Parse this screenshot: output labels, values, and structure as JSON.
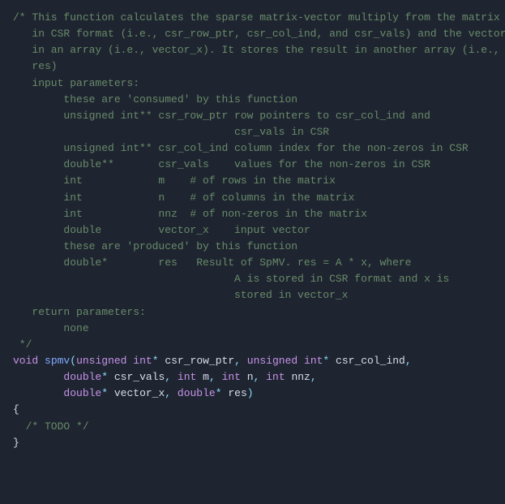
{
  "code": {
    "lines": [
      {
        "type": "comment",
        "text": "/* This function calculates the sparse matrix-vector multiply from the matrix"
      },
      {
        "type": "comment",
        "text": "   in CSR format (i.e., csr_row_ptr, csr_col_ind, and csr_vals) and the vector"
      },
      {
        "type": "comment",
        "text": "   in an array (i.e., vector_x). It stores the result in another array (i.e.,"
      },
      {
        "type": "comment",
        "text": "   res)"
      },
      {
        "type": "comment",
        "text": "   input parameters:"
      },
      {
        "type": "comment",
        "text": "        these are 'consumed' by this function"
      },
      {
        "type": "comment",
        "text": "        unsigned int** csr_row_ptr row pointers to csr_col_ind and"
      },
      {
        "type": "comment",
        "text": "                                   csr_vals in CSR"
      },
      {
        "type": "comment",
        "text": "        unsigned int** csr_col_ind column index for the non-zeros in CSR"
      },
      {
        "type": "comment",
        "text": "        double**       csr_vals    values for the non-zeros in CSR"
      },
      {
        "type": "comment",
        "text": "        int            m    # of rows in the matrix"
      },
      {
        "type": "comment",
        "text": "        int            n    # of columns in the matrix"
      },
      {
        "type": "comment",
        "text": "        int            nnz  # of non-zeros in the matrix"
      },
      {
        "type": "comment",
        "text": "        double         vector_x    input vector"
      },
      {
        "type": "comment",
        "text": ""
      },
      {
        "type": "comment",
        "text": "        these are 'produced' by this function"
      },
      {
        "type": "comment",
        "text": "        double*        res   Result of SpMV. res = A * x, where"
      },
      {
        "type": "comment",
        "text": "                                   A is stored in CSR format and x is"
      },
      {
        "type": "comment",
        "text": "                                   stored in vector_x"
      },
      {
        "type": "comment",
        "text": "   return parameters:"
      },
      {
        "type": "comment",
        "text": "        none"
      },
      {
        "type": "comment",
        "text": ""
      },
      {
        "type": "comment",
        "text": " */"
      },
      {
        "type": "mixed_func",
        "text": "void spmv(unsigned int* csr_row_ptr, unsigned int* csr_col_ind,"
      },
      {
        "type": "mixed_params",
        "text": "        double* csr_vals, int m, int n, int nnz,"
      },
      {
        "type": "mixed_params2",
        "text": "        double* vector_x, double* res)"
      },
      {
        "type": "brace_open",
        "text": "{"
      },
      {
        "type": "todo",
        "text": "  /* TODO */"
      },
      {
        "type": "brace_close",
        "text": "}"
      }
    ]
  }
}
